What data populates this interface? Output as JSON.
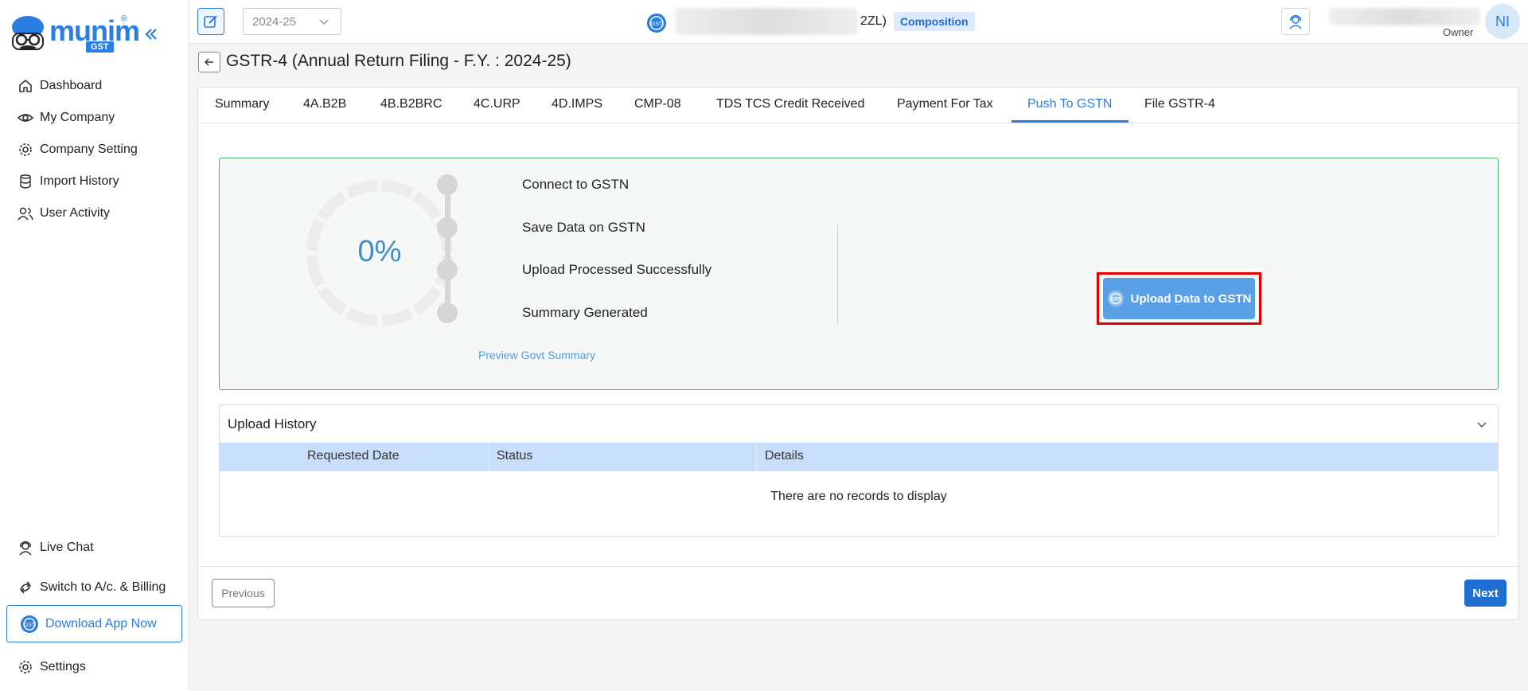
{
  "brand": {
    "name": "munim",
    "badge": "GST",
    "reg": "®"
  },
  "sidebar": {
    "collapse_icon": "double-chevron-left-icon",
    "items": [
      {
        "label": "Dashboard",
        "icon": "home-icon"
      },
      {
        "label": "My Company",
        "icon": "eye-icon"
      },
      {
        "label": "Company Setting",
        "icon": "gear-icon"
      },
      {
        "label": "Import History",
        "icon": "database-icon"
      },
      {
        "label": "User Activity",
        "icon": "users-icon"
      }
    ],
    "bottom": {
      "live_chat": "Live Chat",
      "switch_billing": "Switch to A/c. & Billing",
      "download_app": "Download App Now",
      "settings": "Settings"
    }
  },
  "topbar": {
    "year": "2024-25",
    "company_suffix": "2ZL)",
    "scheme_badge": "Composition",
    "user_role": "Owner",
    "avatar_initials": "NI"
  },
  "page": {
    "back_icon": "arrow-left-icon",
    "title": "GSTR-4 (Annual Return Filing - F.Y. : 2024-25)"
  },
  "tabs": [
    {
      "label": "Summary"
    },
    {
      "label": "4A.B2B"
    },
    {
      "label": "4B.B2BRC"
    },
    {
      "label": "4C.URP"
    },
    {
      "label": "4D.IMPS"
    },
    {
      "label": "CMP-08"
    },
    {
      "label": "TDS TCS Credit Received"
    },
    {
      "label": "Payment For Tax"
    },
    {
      "label": "Push To GSTN",
      "active": true
    },
    {
      "label": "File GSTR-4"
    }
  ],
  "progress": {
    "percent_text": "0%",
    "percent_value": 0,
    "steps": [
      "Connect to GSTN",
      "Save Data on GSTN",
      "Upload Processed Successfully",
      "Summary Generated"
    ],
    "preview_link": "Preview Govt Summary",
    "upload_button": "Upload Data to GSTN"
  },
  "history": {
    "title": "Upload History",
    "columns": [
      "Requested Date",
      "Status",
      "Details"
    ],
    "empty_text": "There are no records to display"
  },
  "footer": {
    "previous": "Previous",
    "next": "Next"
  },
  "colors": {
    "accent": "#2a7de1",
    "success_border": "#4caf6e",
    "highlight": "#e00000"
  }
}
